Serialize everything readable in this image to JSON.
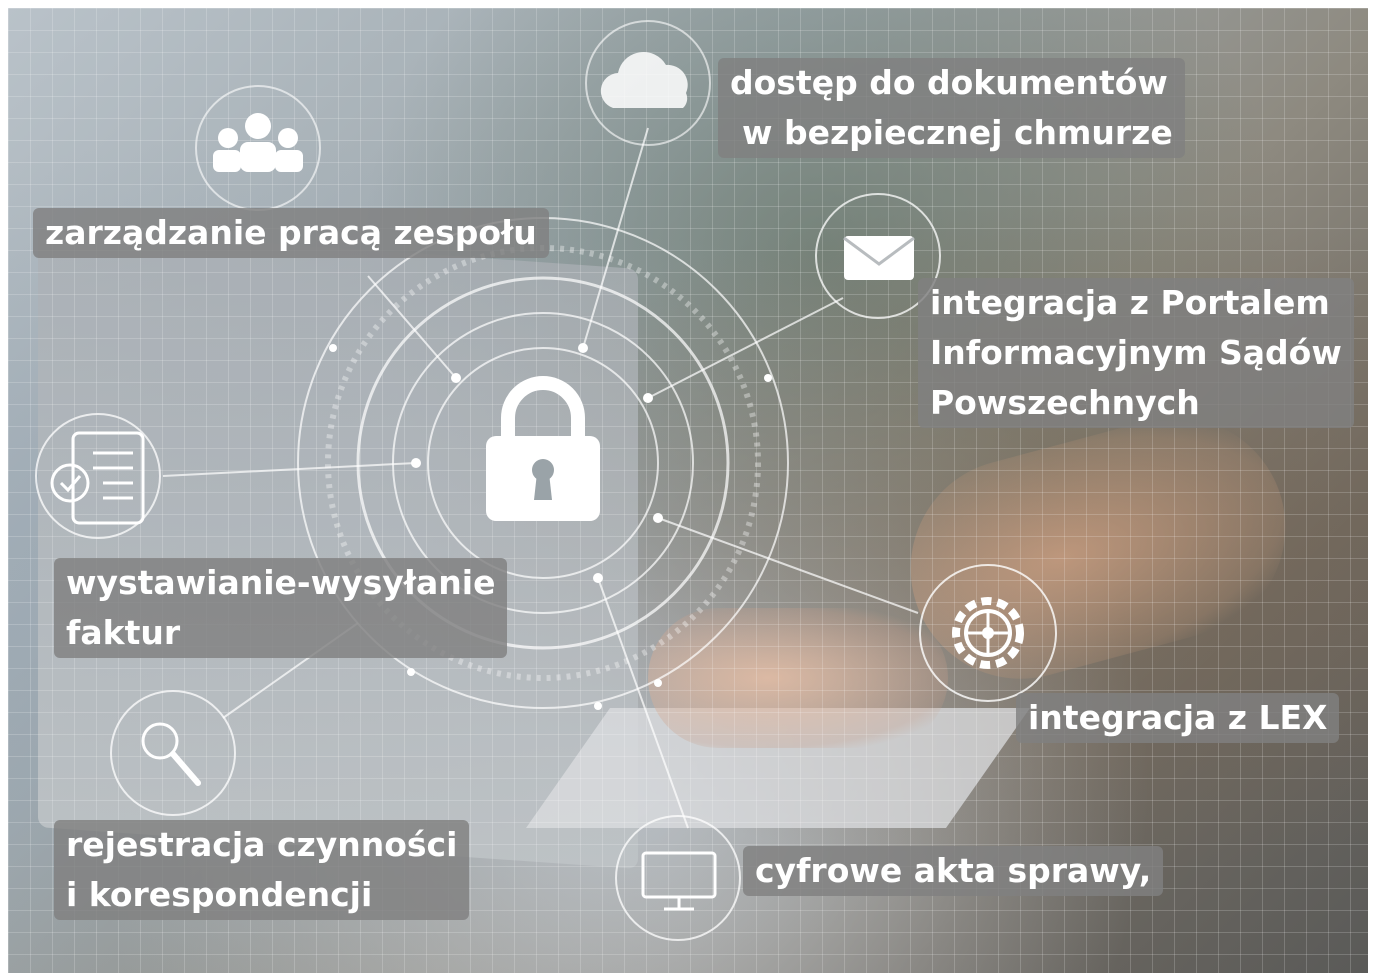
{
  "labels": {
    "cloud": [
      "dostęp do dokumentów",
      "w bezpiecznej chmurze"
    ],
    "team": [
      "zarządzanie pracą zespołu"
    ],
    "portal": [
      "integracja z Portalem",
      "Informacyjnym Sądów",
      "Powszechnych"
    ],
    "invoices": [
      "wystawianie-wysyłanie",
      "faktur"
    ],
    "lex": [
      "integracja z LEX"
    ],
    "register": [
      "rejestracja czynności",
      "i korespondencji"
    ],
    "files": [
      "cyfrowe akta sprawy,"
    ]
  },
  "icons": [
    "cloud-icon",
    "team-icon",
    "envelope-icon",
    "lock-icon",
    "document-icon",
    "gear-icon",
    "magnifier-icon",
    "monitor-icon"
  ],
  "colors": {
    "label_background": "#808080",
    "label_text": "#ffffff",
    "line": "#ffffff"
  }
}
